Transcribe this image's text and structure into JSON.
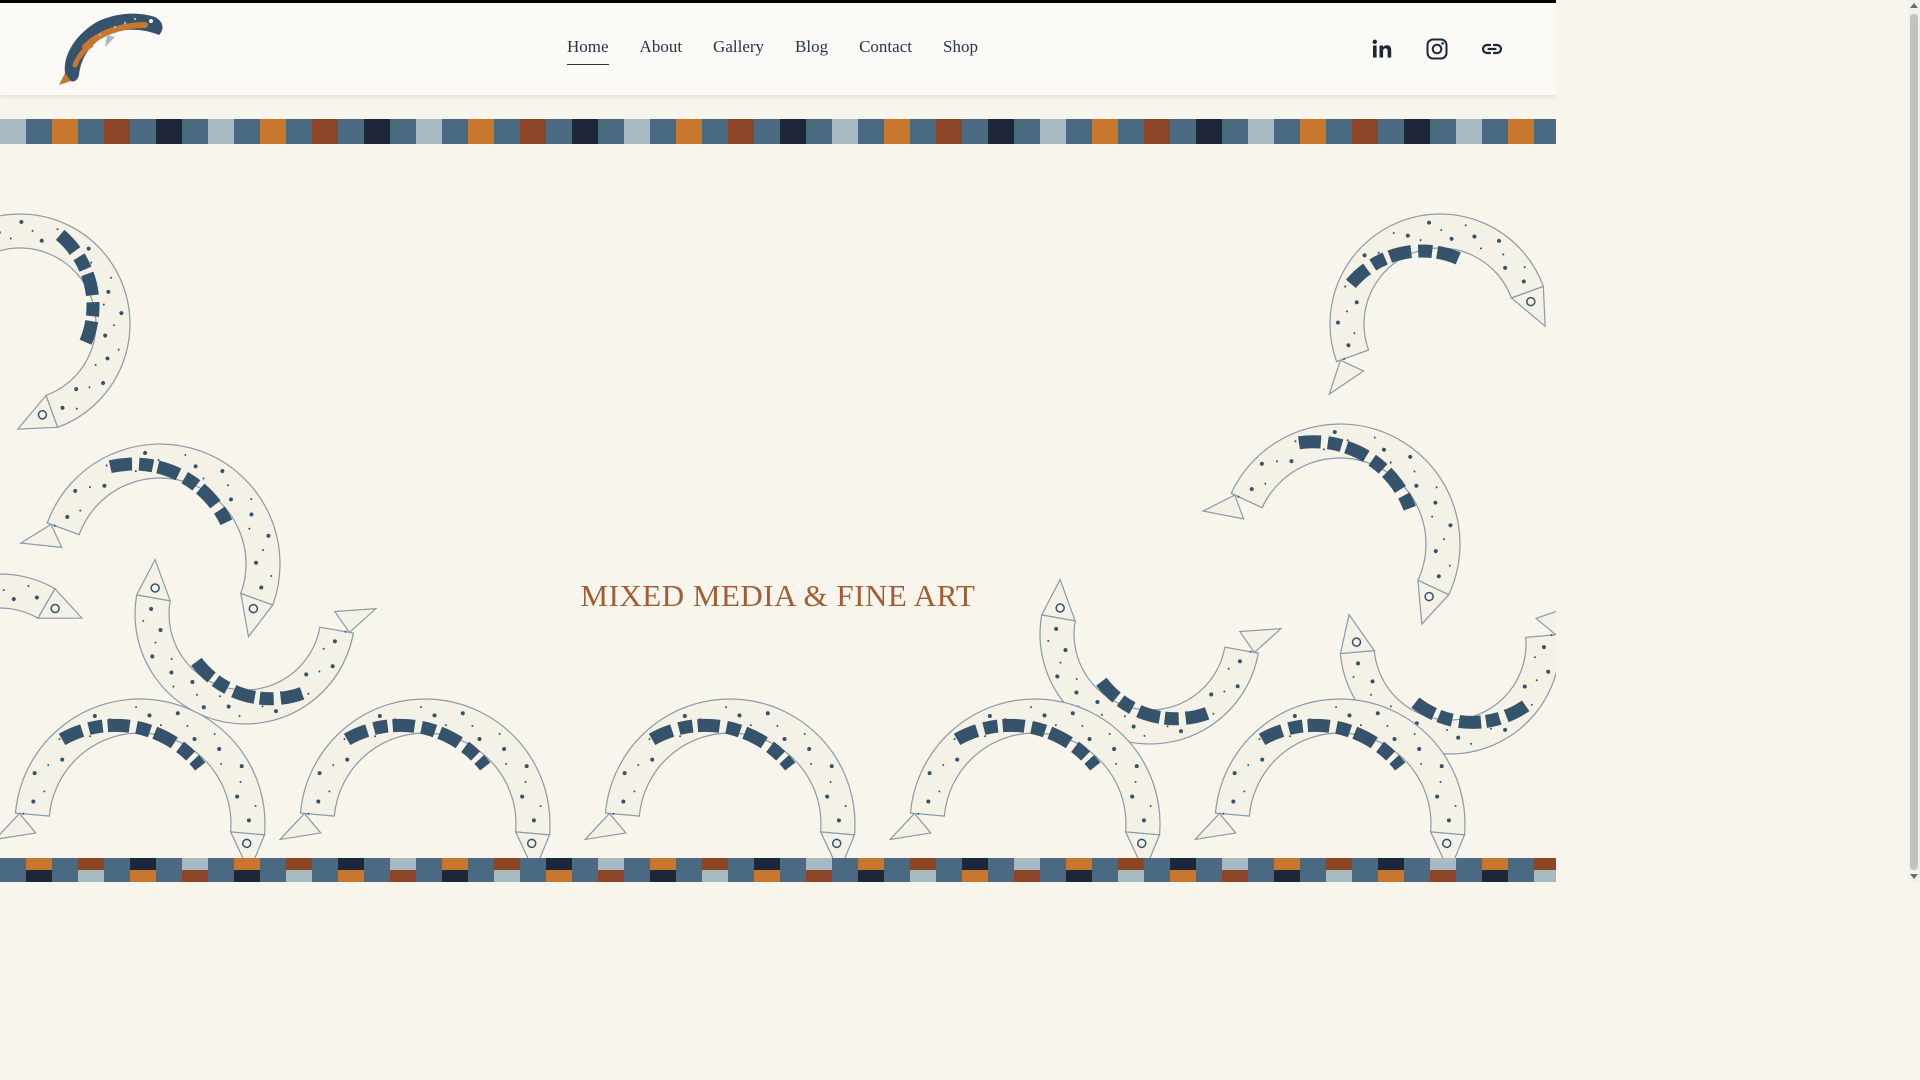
{
  "header": {
    "logo_icon": "pike-fish-logo-icon",
    "nav": [
      {
        "label": "Home",
        "active": true
      },
      {
        "label": "About",
        "active": false
      },
      {
        "label": "Gallery",
        "active": false
      },
      {
        "label": "Blog",
        "active": false
      },
      {
        "label": "Contact",
        "active": false
      },
      {
        "label": "Shop",
        "active": false
      }
    ],
    "social": [
      {
        "name": "linkedin-icon"
      },
      {
        "name": "instagram-icon"
      },
      {
        "name": "link-icon"
      }
    ]
  },
  "hero": {
    "title": "MIXED MEDIA & FINE ART"
  },
  "colors": {
    "background": "#f8f5ec",
    "accent": "#a15d34",
    "navy": "#1e2738",
    "slate": "#4a6a82",
    "sky": "#a7bac1",
    "orange": "#c8772e",
    "rust": "#8d4527",
    "fish_ink": "#35536b"
  },
  "stripe_pattern": [
    "#a7bac1",
    "#4a6a82",
    "#c8772e",
    "#4a6a82",
    "#8d4527",
    "#4a6a82",
    "#1e2738",
    "#4a6a82"
  ]
}
